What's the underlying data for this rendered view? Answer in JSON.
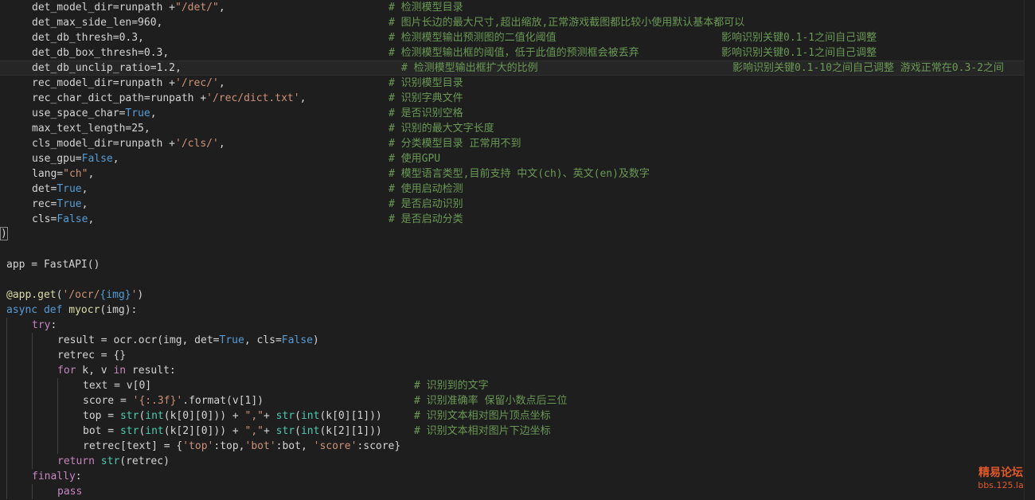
{
  "theme": {
    "background": "#1e1e1e",
    "comment": "#6a9955",
    "string": "#ce9178",
    "keyword": "#569cd6",
    "function": "#dcdcaa",
    "builtin": "#4ec9b0",
    "flow": "#c586c0"
  },
  "lines": [
    {
      "indent": 1,
      "tokens": [
        [
          "det_model_dir=runpath +",
          "d"
        ],
        [
          "\"/det/\"",
          "s"
        ],
        [
          ",",
          "d"
        ]
      ],
      "comment": "# 检测模型目录"
    },
    {
      "indent": 1,
      "tokens": [
        [
          "det_max_side_len=960,",
          "d"
        ]
      ],
      "comment": "# 图片长边的最大尺寸,超出缩放,正常游戏截图都比较小使用默认基本都可以"
    },
    {
      "indent": 1,
      "tokens": [
        [
          "det_db_thresh=0.3,",
          "d"
        ]
      ],
      "comment": "# 检测模型输出预测图的二值化阈值",
      "comment2": "影响识别关键0.1-1之间自己调整"
    },
    {
      "indent": 1,
      "tokens": [
        [
          "det_db_box_thresh=0.3,",
          "d"
        ]
      ],
      "comment": "# 检测模型输出框的阈值，低于此值的预测框会被丢弃",
      "comment2": "影响识别关键0.1-1之间自己调整"
    },
    {
      "indent": 1,
      "current": true,
      "tokens": [
        [
          "det_db_unclip_ratio=1.2,",
          "d"
        ]
      ],
      "comment": "# 检测模型输出框扩大的比例",
      "comment2": "影响识别关键0.1-10之间自己调整 游戏正常在0.3-2之间",
      "offset": true
    },
    {
      "indent": 1,
      "tokens": [
        [
          "rec_model_dir=runpath +",
          "d"
        ],
        [
          "'/rec/'",
          "s"
        ],
        [
          ",",
          "d"
        ]
      ],
      "comment": "# 识别模型目录"
    },
    {
      "indent": 1,
      "tokens": [
        [
          "rec_char_dict_path=runpath +",
          "d"
        ],
        [
          "'/rec/dict.txt'",
          "s"
        ],
        [
          ",",
          "d"
        ]
      ],
      "comment": "# 识别字典文件"
    },
    {
      "indent": 1,
      "tokens": [
        [
          "use_space_char=",
          "d"
        ],
        [
          "True",
          "k"
        ],
        [
          ",",
          "d"
        ]
      ],
      "comment": "# 是否识别空格"
    },
    {
      "indent": 1,
      "tokens": [
        [
          "max_text_length=25,",
          "d"
        ]
      ],
      "comment": "# 识别的最大文字长度"
    },
    {
      "indent": 1,
      "tokens": [
        [
          "cls_model_dir=runpath +",
          "d"
        ],
        [
          "'/cls/'",
          "s"
        ],
        [
          ",",
          "d"
        ]
      ],
      "comment": "# 分类模型目录 正常用不到"
    },
    {
      "indent": 1,
      "tokens": [
        [
          "use_gpu=",
          "d"
        ],
        [
          "False",
          "k"
        ],
        [
          ",",
          "d"
        ]
      ],
      "comment": "# 使用GPU"
    },
    {
      "indent": 1,
      "tokens": [
        [
          "lang=",
          "d"
        ],
        [
          "\"ch\"",
          "s"
        ],
        [
          ",",
          "d"
        ]
      ],
      "comment": "# 模型语言类型,目前支持 中文(ch)、英文(en)及数字"
    },
    {
      "indent": 1,
      "tokens": [
        [
          "det=",
          "d"
        ],
        [
          "True",
          "k"
        ],
        [
          ",",
          "d"
        ]
      ],
      "comment": "# 使用启动检测"
    },
    {
      "indent": 1,
      "tokens": [
        [
          "rec=",
          "d"
        ],
        [
          "True",
          "k"
        ],
        [
          ",",
          "d"
        ]
      ],
      "comment": "# 是否启动识别"
    },
    {
      "indent": 1,
      "tokens": [
        [
          "cls=",
          "d"
        ],
        [
          "False",
          "k"
        ],
        [
          ",",
          "d"
        ]
      ],
      "comment": "# 是否启动分类"
    },
    {
      "indent": 0,
      "bracket": ")",
      "tokens": []
    },
    {
      "indent": 0,
      "tokens": []
    },
    {
      "indent": 0,
      "tokens": [
        [
          "app = FastAPI()",
          "d"
        ]
      ]
    },
    {
      "indent": 0,
      "tokens": []
    },
    {
      "indent": 0,
      "tokens": [
        [
          "@app.get",
          "f"
        ],
        [
          "(",
          "d"
        ],
        [
          "'/ocr/",
          "s"
        ],
        [
          "{img}",
          "k"
        ],
        [
          "'",
          "s"
        ],
        [
          ")",
          "d"
        ]
      ]
    },
    {
      "indent": 0,
      "tokens": [
        [
          "async",
          "k"
        ],
        [
          " ",
          "d"
        ],
        [
          "def",
          "k"
        ],
        [
          " ",
          "d"
        ],
        [
          "myocr",
          "f"
        ],
        [
          "(img):",
          "d"
        ]
      ]
    },
    {
      "indent": 1,
      "tokens": [
        [
          "try",
          "p"
        ],
        [
          ":",
          "d"
        ]
      ]
    },
    {
      "indent": 2,
      "tokens": [
        [
          "result = ocr.ocr(img, det=",
          "d"
        ],
        [
          "True",
          "k"
        ],
        [
          ", cls=",
          "d"
        ],
        [
          "False",
          "k"
        ],
        [
          ")",
          "d"
        ]
      ]
    },
    {
      "indent": 2,
      "tokens": [
        [
          "retrec = {}",
          "d"
        ]
      ]
    },
    {
      "indent": 2,
      "tokens": [
        [
          "for",
          "p"
        ],
        [
          " k, v ",
          "d"
        ],
        [
          "in",
          "p"
        ],
        [
          " result:",
          "d"
        ]
      ]
    },
    {
      "indent": 3,
      "tokens": [
        [
          "text = v[0]",
          "d"
        ]
      ],
      "comment": "# 识别到的文字",
      "col": 520
    },
    {
      "indent": 3,
      "tokens": [
        [
          "score = ",
          "d"
        ],
        [
          "'{:.3f}'",
          "s"
        ],
        [
          ".format(v[1])",
          "d"
        ]
      ],
      "comment": "# 识别准确率 保留小数点后三位",
      "col": 520
    },
    {
      "indent": 3,
      "tokens": [
        [
          "top = ",
          "d"
        ],
        [
          "str",
          "b"
        ],
        [
          "(",
          "d"
        ],
        [
          "int",
          "b"
        ],
        [
          "(k[0][0])) + ",
          "d"
        ],
        [
          "\",\"",
          "s"
        ],
        [
          "+ ",
          "d"
        ],
        [
          "str",
          "b"
        ],
        [
          "(",
          "d"
        ],
        [
          "int",
          "b"
        ],
        [
          "(k[0][1]))",
          "d"
        ]
      ],
      "comment": "# 识别文本相对图片顶点坐标",
      "col": 520
    },
    {
      "indent": 3,
      "tokens": [
        [
          "bot = ",
          "d"
        ],
        [
          "str",
          "b"
        ],
        [
          "(",
          "d"
        ],
        [
          "int",
          "b"
        ],
        [
          "(k[2][0])) + ",
          "d"
        ],
        [
          "\",\"",
          "s"
        ],
        [
          "+ ",
          "d"
        ],
        [
          "str",
          "b"
        ],
        [
          "(",
          "d"
        ],
        [
          "int",
          "b"
        ],
        [
          "(k[2][1]))",
          "d"
        ]
      ],
      "comment": "# 识别文本相对图片下边坐标",
      "col": 520
    },
    {
      "indent": 3,
      "tokens": [
        [
          "retrec[text] = {",
          "d"
        ],
        [
          "'top'",
          "s"
        ],
        [
          ":top,",
          "d"
        ],
        [
          "'bot'",
          "s"
        ],
        [
          ":bot, ",
          "d"
        ],
        [
          "'score'",
          "s"
        ],
        [
          ":score}",
          "d"
        ]
      ]
    },
    {
      "indent": 2,
      "tokens": [
        [
          "return",
          "p"
        ],
        [
          " ",
          "d"
        ],
        [
          "str",
          "b"
        ],
        [
          "(retrec)",
          "d"
        ]
      ]
    },
    {
      "indent": 1,
      "tokens": [
        [
          "finally",
          "p"
        ],
        [
          ":",
          "d"
        ]
      ]
    },
    {
      "indent": 2,
      "tokens": [
        [
          "pass",
          "p"
        ]
      ]
    }
  ],
  "watermark": {
    "title": "精易论坛",
    "url": "bbs.125.la"
  }
}
